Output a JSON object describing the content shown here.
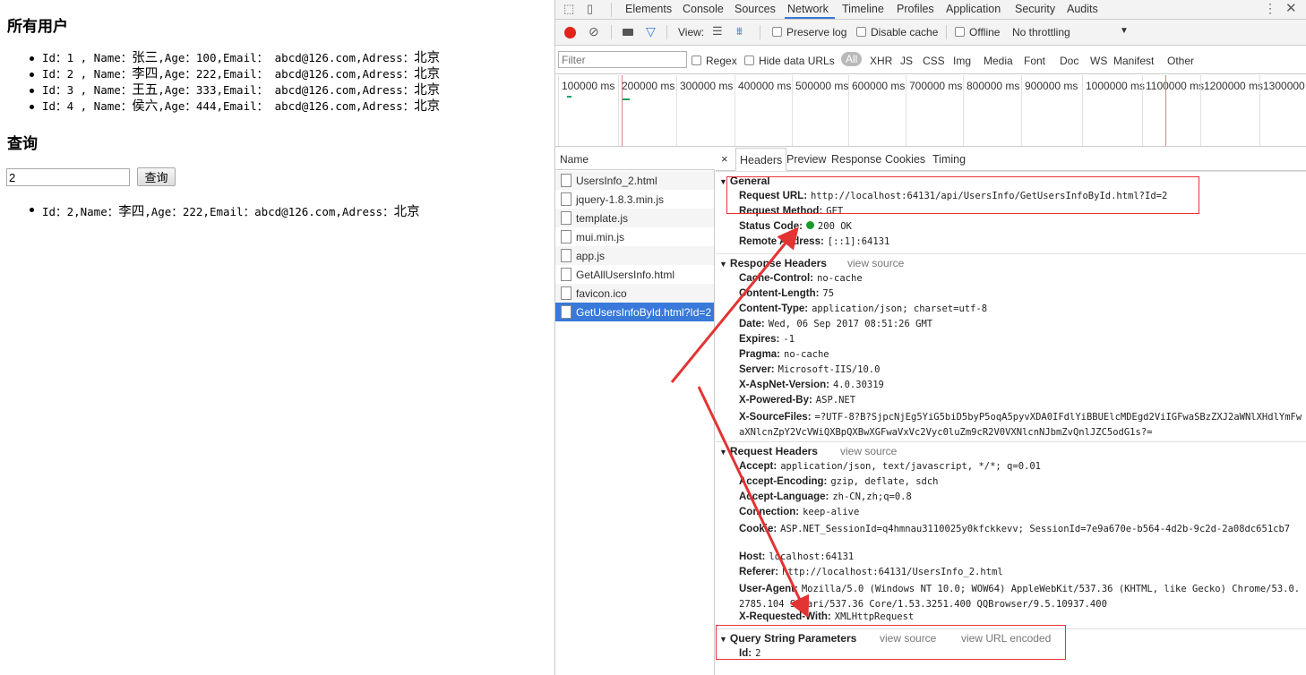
{
  "page": {
    "all_users_heading": "所有用户",
    "users": [
      {
        "id": "1",
        "name": "张三",
        "age": "100",
        "email": "abcd@126.com",
        "address": "北京"
      },
      {
        "id": "2",
        "name": "李四",
        "age": "222",
        "email": "abcd@126.com",
        "address": "北京"
      },
      {
        "id": "3",
        "name": "王五",
        "age": "333",
        "email": "abcd@126.com",
        "address": "北京"
      },
      {
        "id": "4",
        "name": "侯六",
        "age": "444",
        "email": "abcd@126.com",
        "address": "北京"
      }
    ],
    "query_heading": "查询",
    "query_input_value": "2",
    "query_button": "查询",
    "result": {
      "id": "2",
      "name": "李四",
      "age": "222",
      "email": "abcd@126.com",
      "address": "北京"
    }
  },
  "devtools": {
    "tabs": [
      "Elements",
      "Console",
      "Sources",
      "Network",
      "Timeline",
      "Profiles",
      "Application",
      "Security",
      "Audits"
    ],
    "active_tab": "Network",
    "toolbar": {
      "view_label": "View:",
      "preserve_log": "Preserve log",
      "disable_cache": "Disable cache",
      "offline": "Offline",
      "throttling": "No throttling"
    },
    "filter": {
      "placeholder": "Filter",
      "regex": "Regex",
      "hide_data_urls": "Hide data URLs",
      "types": [
        "All",
        "XHR",
        "JS",
        "CSS",
        "Img",
        "Media",
        "Font",
        "Doc",
        "WS",
        "Manifest",
        "Other"
      ]
    },
    "timeline_labels": [
      "100000 ms",
      "200000 ms",
      "300000 ms",
      "400000 ms",
      "500000 ms",
      "600000 ms",
      "700000 ms",
      "800000 ms",
      "900000 ms",
      "1000000 ms",
      "1100000 ms",
      "1200000 ms",
      "1300000 ms"
    ],
    "name_header": "Name",
    "requests": [
      "UsersInfo_2.html",
      "jquery-1.8.3.min.js",
      "template.js",
      "mui.min.js",
      "app.js",
      "GetAllUsersInfo.html",
      "favicon.ico",
      "GetUsersInfoById.html?Id=2"
    ],
    "selected_request_index": 7,
    "detail_tabs": [
      "Headers",
      "Preview",
      "Response",
      "Cookies",
      "Timing"
    ],
    "close_glyph": "×",
    "general": {
      "title": "General",
      "rows": [
        {
          "key": "Request URL:",
          "value": "http://localhost:64131/api/UsersInfo/GetUsersInfoById.html?Id=2"
        },
        {
          "key": "Request Method:",
          "value": "GET"
        },
        {
          "key": "Status Code:",
          "value": "200 OK"
        },
        {
          "key": "Remote Address:",
          "value": "[::1]:64131"
        }
      ]
    },
    "response_headers": {
      "title": "Response Headers",
      "view_source": "view source",
      "rows": [
        {
          "key": "Cache-Control:",
          "value": "no-cache"
        },
        {
          "key": "Content-Length:",
          "value": "75"
        },
        {
          "key": "Content-Type:",
          "value": "application/json; charset=utf-8"
        },
        {
          "key": "Date:",
          "value": "Wed, 06 Sep 2017 08:51:26 GMT"
        },
        {
          "key": "Expires:",
          "value": "-1"
        },
        {
          "key": "Pragma:",
          "value": "no-cache"
        },
        {
          "key": "Server:",
          "value": "Microsoft-IIS/10.0"
        },
        {
          "key": "X-AspNet-Version:",
          "value": "4.0.30319"
        },
        {
          "key": "X-Powered-By:",
          "value": "ASP.NET"
        },
        {
          "key": "X-SourceFiles:",
          "value": "=?UTF-8?B?SjpcNjEg5YiG5biD5byP5oqA5pyvXDA0IFdlYiBBUElcMDEgd2ViIGFwaSBzZXJ2aWNlXHdlYmFwaXNlcnZpY2VcVWiQXBpQXBwXGFwaVxVc2Vyc0luZm9cR2V0VXNlcnNJbmZvQnlJZC5odG1s?="
        }
      ]
    },
    "request_headers": {
      "title": "Request Headers",
      "view_source": "view source",
      "rows": [
        {
          "key": "Accept:",
          "value": "application/json, text/javascript, */*; q=0.01"
        },
        {
          "key": "Accept-Encoding:",
          "value": "gzip, deflate, sdch"
        },
        {
          "key": "Accept-Language:",
          "value": "zh-CN,zh;q=0.8"
        },
        {
          "key": "Connection:",
          "value": "keep-alive"
        },
        {
          "key": "Cookie:",
          "value": "ASP.NET_SessionId=q4hmnau3110025y0kfckkevv; SessionId=7e9a670e-b564-4d2b-9c2d-2a08dc651cb7"
        },
        {
          "key": "Host:",
          "value": "localhost:64131"
        },
        {
          "key": "Referer:",
          "value": "http://localhost:64131/UsersInfo_2.html"
        },
        {
          "key": "User-Agent:",
          "value": "Mozilla/5.0 (Windows NT 10.0; WOW64) AppleWebKit/537.36 (KHTML, like Gecko) Chrome/53.0.2785.104 Safari/537.36 Core/1.53.3251.400 QQBrowser/9.5.10937.400"
        },
        {
          "key": "X-Requested-With:",
          "value": "XMLHttpRequest"
        }
      ]
    },
    "query_params": {
      "title": "Query String Parameters",
      "view_source": "view source",
      "view_url_encoded": "view URL encoded",
      "rows": [
        {
          "key": "Id:",
          "value": "2"
        }
      ]
    }
  },
  "colors": {
    "annotation": "#e33333",
    "accent": "#3879d9",
    "status_ok": "#1a9a2a"
  }
}
